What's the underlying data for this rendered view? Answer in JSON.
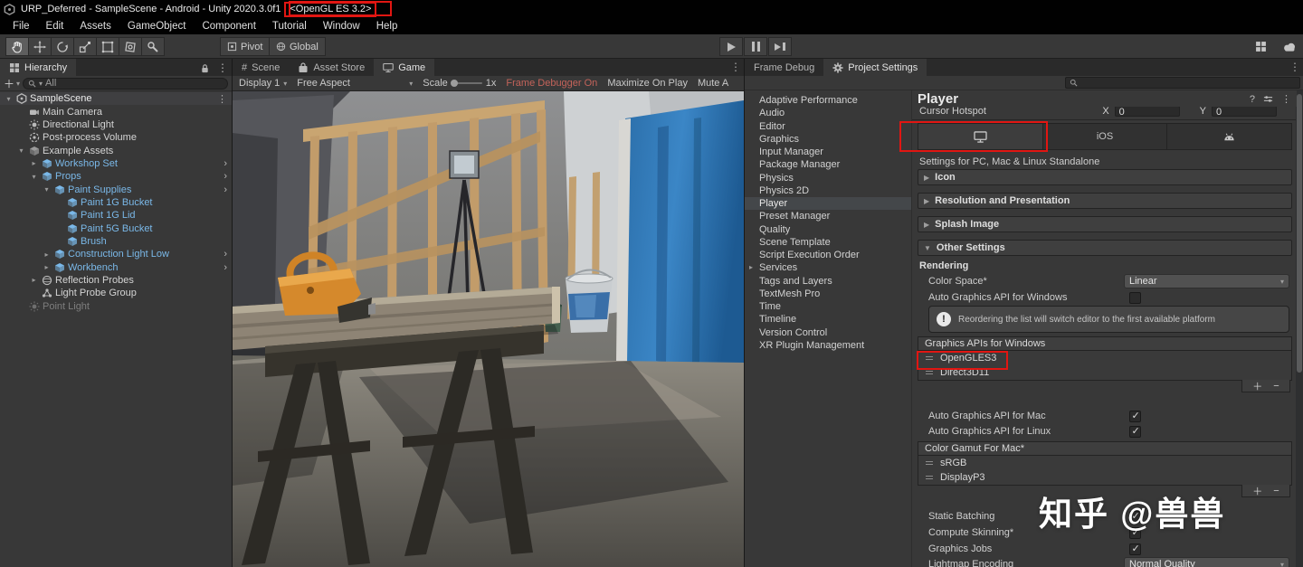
{
  "colors": {
    "accent_red": "#e11612",
    "prefab_blue": "#7ab8e8",
    "frame_debugger_text": "#c4635a",
    "selection_gray": "#44474a",
    "panel_bg": "#383838",
    "blue_wall": "#2f7fbe"
  },
  "title_bar": {
    "title": "URP_Deferred - SampleScene - Android - Unity 2020.3.0f1",
    "api_badge": "<OpenGL ES 3.2>"
  },
  "menu": {
    "items": [
      "File",
      "Edit",
      "Assets",
      "GameObject",
      "Component",
      "Tutorial",
      "Window",
      "Help"
    ]
  },
  "toolbar": {
    "pivot": "Pivot",
    "global": "Global"
  },
  "hierarchy": {
    "tab": "Hierarchy",
    "search_value": "All",
    "items": [
      {
        "label": "SampleScene"
      },
      {
        "label": "Main Camera"
      },
      {
        "label": "Directional Light"
      },
      {
        "label": "Post-process Volume"
      },
      {
        "label": "Example Assets"
      },
      {
        "label": "Workshop Set"
      },
      {
        "label": "Props"
      },
      {
        "label": "Paint Supplies"
      },
      {
        "label": "Paint 1G Bucket"
      },
      {
        "label": "Paint 1G Lid"
      },
      {
        "label": "Paint 5G Bucket"
      },
      {
        "label": "Brush"
      },
      {
        "label": "Construction Light Low"
      },
      {
        "label": "Workbench"
      },
      {
        "label": "Reflection Probes"
      },
      {
        "label": "Light Probe Group"
      },
      {
        "label": "Point Light"
      }
    ]
  },
  "scene_panel": {
    "tabs": {
      "scene": "Scene",
      "asset_store": "Asset Store",
      "game": "Game"
    }
  },
  "game_bar": {
    "display": "Display 1",
    "aspect": "Free Aspect",
    "scale_label": "Scale",
    "scale_value": "1x",
    "frame_debugger": "Frame Debugger On",
    "maximize": "Maximize On Play",
    "mute": "Mute A"
  },
  "right_panel": {
    "tabs": {
      "frame_debug": "Frame Debug",
      "project_settings": "Project Settings"
    }
  },
  "settings_nav": {
    "selected": "Player",
    "items": [
      "Adaptive Performance",
      "Audio",
      "Editor",
      "Graphics",
      "Input Manager",
      "Package Manager",
      "Physics",
      "Physics 2D",
      "Player",
      "Preset Manager",
      "Quality",
      "Scene Template",
      "Script Execution Order",
      "Services",
      "Tags and Layers",
      "TextMesh Pro",
      "Time",
      "Timeline",
      "Version Control",
      "XR Plugin Management"
    ]
  },
  "player": {
    "title": "Player",
    "cursor": {
      "label": "Cursor Hotspot",
      "x_label": "X",
      "x_value": "0",
      "y_label": "Y",
      "y_value": "0"
    },
    "platforms": {
      "ios": "iOS"
    },
    "settings_for": "Settings for PC, Mac & Linux Standalone",
    "sections": {
      "icon": "Icon",
      "resolution": "Resolution and Presentation",
      "splash": "Splash Image",
      "other": "Other Settings"
    },
    "rendering": {
      "header": "Rendering",
      "color_space_label": "Color Space*",
      "color_space_value": "Linear",
      "auto_api_windows": "Auto Graphics API  for Windows",
      "auto_windows_checked": false,
      "info": "Reordering the list will switch editor to the first available platform",
      "apis_header": "Graphics APIs for Windows",
      "apis": [
        "OpenGLES3",
        "Direct3D11"
      ],
      "auto_api_mac": "Auto Graphics API  for Mac",
      "auto_mac_checked": true,
      "auto_api_linux": "Auto Graphics API  for Linux",
      "auto_linux_checked": true,
      "gamut_header": "Color Gamut For Mac*",
      "gamuts": [
        "sRGB",
        "DisplayP3"
      ],
      "static_batching": "Static Batching",
      "static_batching_checked": true,
      "compute_skinning": "Compute Skinning*",
      "compute_skinning_checked": true,
      "graphics_jobs": "Graphics Jobs",
      "graphics_jobs_checked": true,
      "lightmap_label": "Lightmap Encoding",
      "lightmap_value": "Normal Quality"
    }
  },
  "watermark": "知乎 @兽兽"
}
